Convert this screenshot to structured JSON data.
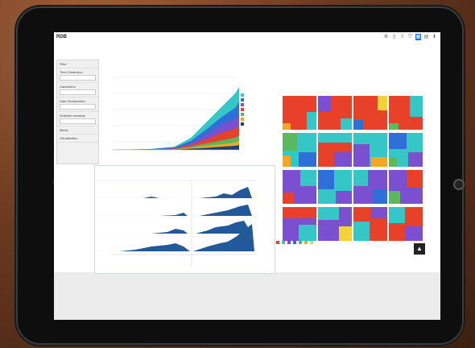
{
  "app": {
    "title": "RDB"
  },
  "toolbar": {
    "icons": [
      "gear-icon",
      "bookmark-icon",
      "export-icon",
      "filter-icon",
      "grid-icon",
      "layout-icon",
      "download-icon"
    ]
  },
  "sidebar": {
    "items": [
      {
        "label": "Filter",
        "value": ""
      },
      {
        "label": "Time Dimension",
        "value": ""
      },
      {
        "label": "Calculation",
        "value": ""
      },
      {
        "label": "Data Visualization",
        "value": ""
      },
      {
        "label": "Selected measure",
        "value": ""
      },
      {
        "label": "Metric",
        "value": ""
      },
      {
        "label": "Visualization",
        "value": ""
      }
    ]
  },
  "colors": {
    "red": "#e8412a",
    "purple": "#7a4fd0",
    "teal": "#35c7c8",
    "orange": "#f5a623",
    "green": "#5bb85c",
    "blue": "#2f6fd8",
    "navy": "#1f3f7a",
    "yellow": "#f2d234",
    "darkblue": "#22599a"
  }
}
